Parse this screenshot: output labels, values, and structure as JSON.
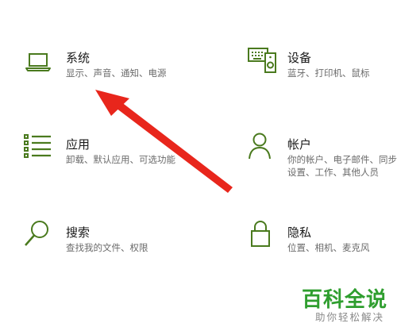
{
  "accent_color": "#4a7a1e",
  "arrow_color": "#e8261c",
  "tiles": {
    "system": {
      "icon": "laptop-icon",
      "title": "系统",
      "desc": "显示、声音、通知、电源"
    },
    "devices": {
      "icon": "keyboard-speaker-icon",
      "title": "设备",
      "desc": "蓝牙、打印机、鼠标"
    },
    "apps": {
      "icon": "apps-list-icon",
      "title": "应用",
      "desc": "卸载、默认应用、可选功能"
    },
    "accounts": {
      "icon": "person-icon",
      "title": "帐户",
      "desc": "你的帐户、电子邮件、同步设置、工作、其他人员"
    },
    "search": {
      "icon": "magnifier-icon",
      "title": "搜索",
      "desc": "查找我的文件、权限"
    },
    "privacy": {
      "icon": "lock-icon",
      "title": "隐私",
      "desc": "位置、相机、麦克风"
    }
  },
  "watermark": {
    "title": "百科全说",
    "subtitle": "助你轻松解决"
  }
}
